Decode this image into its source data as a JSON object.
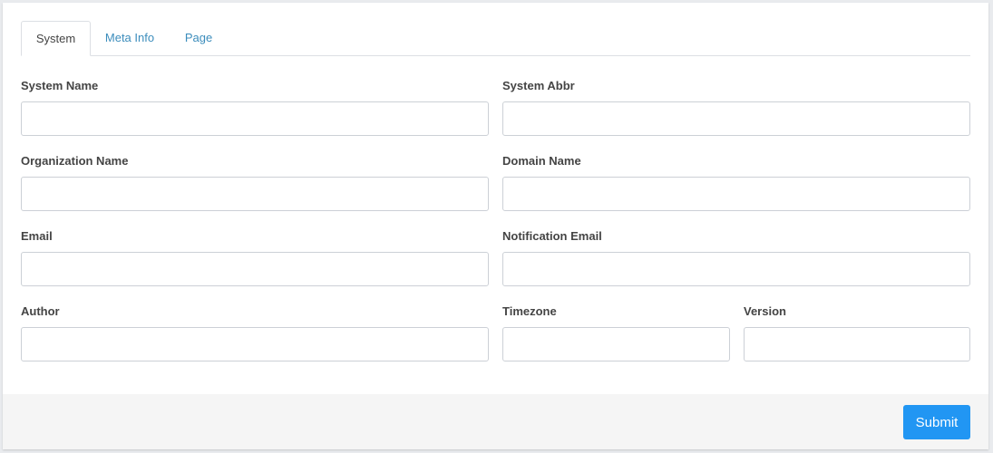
{
  "tabs": [
    {
      "label": "System",
      "active": true
    },
    {
      "label": "Meta Info",
      "active": false
    },
    {
      "label": "Page",
      "active": false
    }
  ],
  "form": {
    "system_name": {
      "label": "System Name",
      "value": "",
      "placeholder": ""
    },
    "system_abbr": {
      "label": "System Abbr",
      "value": "",
      "placeholder": ""
    },
    "organization_name": {
      "label": "Organization Name",
      "value": "",
      "placeholder": ""
    },
    "domain_name": {
      "label": "Domain Name",
      "value": "",
      "placeholder": ""
    },
    "email": {
      "label": "Email",
      "value": "",
      "placeholder": ""
    },
    "notification_email": {
      "label": "Notification Email",
      "value": "",
      "placeholder": ""
    },
    "author": {
      "label": "Author",
      "value": "",
      "placeholder": ""
    },
    "timezone": {
      "label": "Timezone",
      "value": "",
      "placeholder": ""
    },
    "version": {
      "label": "Version",
      "value": "",
      "placeholder": ""
    }
  },
  "footer": {
    "submit_label": "Submit"
  },
  "colors": {
    "accent": "#2196f3",
    "tab_link": "#3c8dbc",
    "footer_bg": "#f5f5f5"
  }
}
